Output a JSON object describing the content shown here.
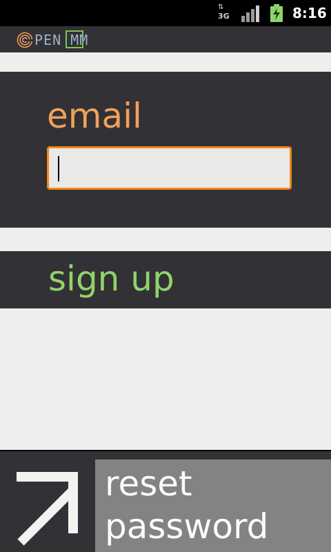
{
  "status_bar": {
    "network_type": "3G",
    "data_arrows": "⇅",
    "time": "8:16"
  },
  "app": {
    "logo_text": "PEN MM"
  },
  "email": {
    "label": "email",
    "value": "",
    "placeholder": ""
  },
  "signup": {
    "label": "sign up"
  },
  "bottom": {
    "reset_label": "reset password"
  },
  "colors": {
    "panel_dark": "#323135",
    "background": "#eeefec",
    "email_label": "#f0a05a",
    "input_border": "#ef8a1c",
    "signup_label": "#8fd46a",
    "reset_button": "#838383",
    "logo_box": "#7cc552"
  },
  "icons": {
    "status": [
      "3g-data-icon",
      "signal-strength-icon",
      "battery-charging-icon"
    ],
    "logo": "openomm-swirl-logo-icon",
    "bottom_left": "arrow-up-right-icon"
  }
}
